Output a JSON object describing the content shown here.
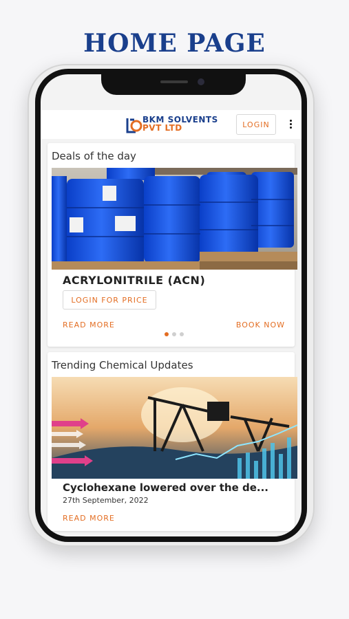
{
  "page_title": "HOME PAGE",
  "header": {
    "brand_line1": "BKM SOLVENTS",
    "brand_line2": "PVT LTD",
    "login_label": "LOGIN",
    "menu_icon": "kebab-menu-icon"
  },
  "deals": {
    "section_title": "Deals of the day",
    "image": "blue-chemical-drums",
    "product_name": "ACRYLONITRILE (ACN)",
    "price_button": "LOGIN FOR PRICE",
    "read_more": "READ MORE",
    "book_now": "BOOK NOW",
    "carousel_total": 3,
    "carousel_active": 1
  },
  "trending": {
    "section_title": "Trending Chemical Updates",
    "image": "oil-pump-market-chart",
    "news_title": "Cyclohexane lowered over the de...",
    "news_date": "27th September, 2022",
    "read_more": "READ MORE"
  },
  "colors": {
    "brand_blue": "#1a3f8c",
    "accent_orange": "#e36d22"
  }
}
